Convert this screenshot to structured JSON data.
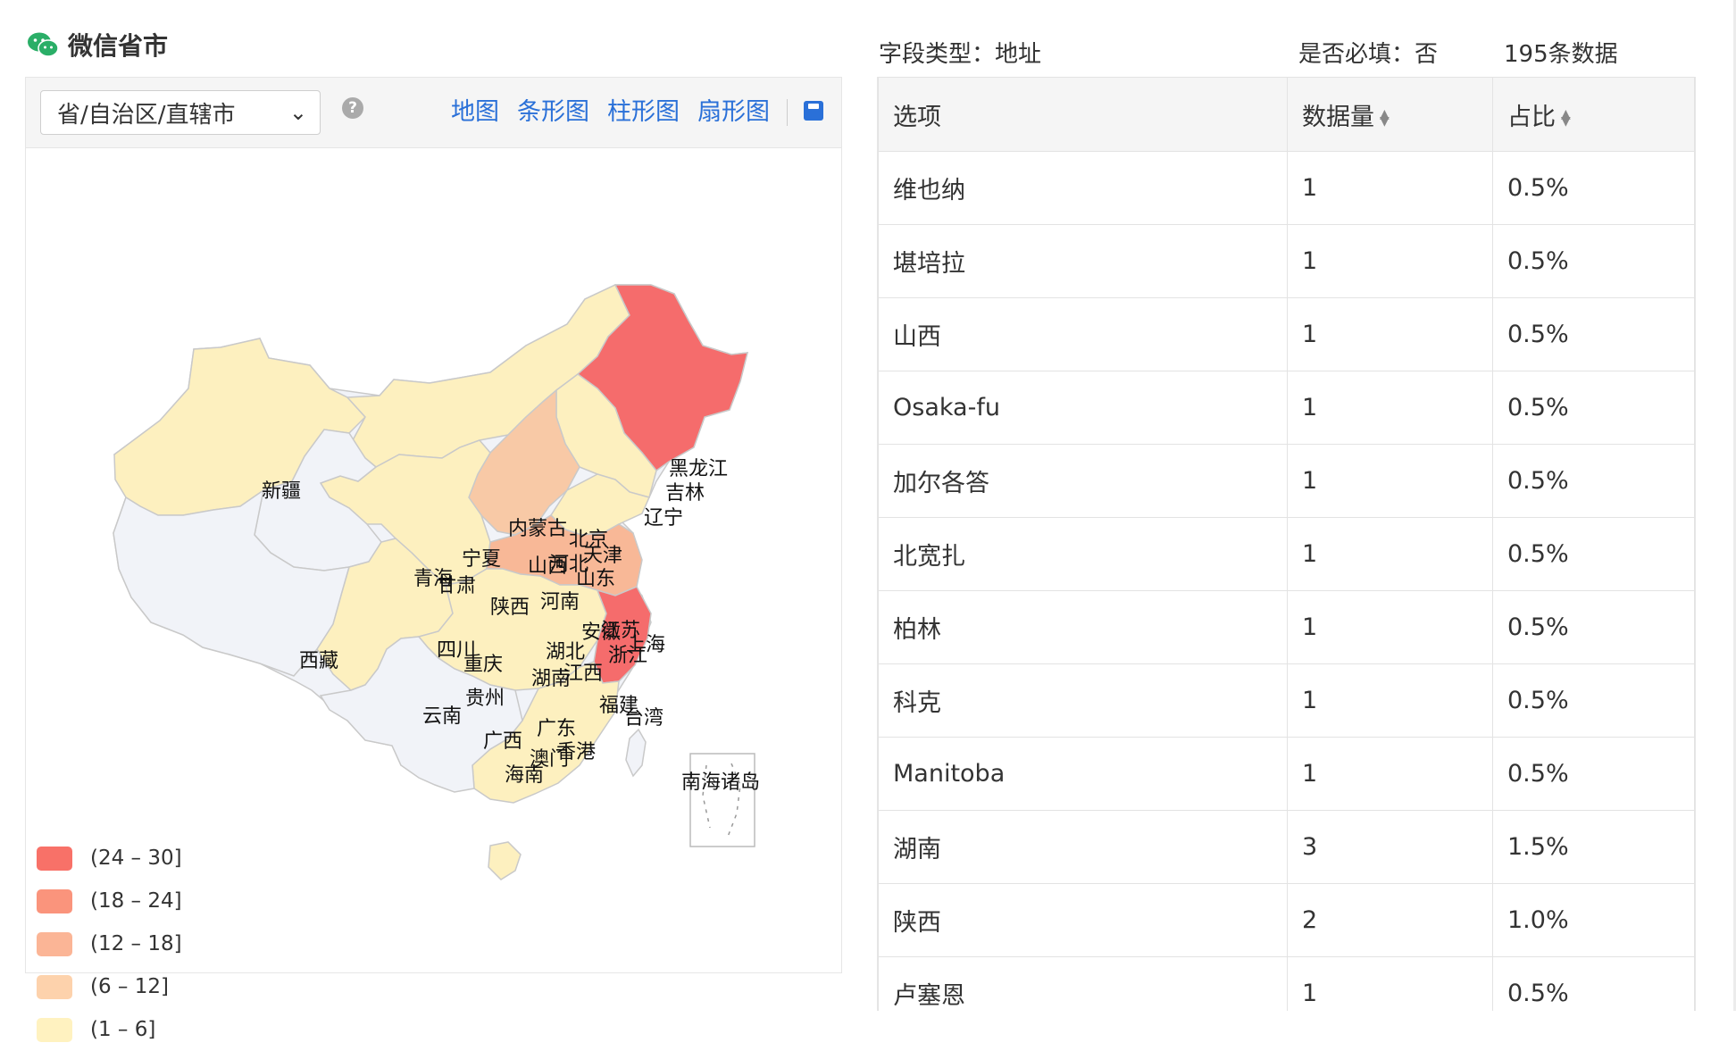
{
  "header": {
    "title": "微信省市",
    "icon": "wechat-icon"
  },
  "toolbar": {
    "select_value": "省/自治区/直辖市",
    "help_icon": "?",
    "tabs": [
      "地图",
      "条形图",
      "柱形图",
      "扇形图"
    ],
    "save_icon": "save-icon"
  },
  "map": {
    "regions": [
      {
        "name": "黑龙江"
      },
      {
        "name": "吉林"
      },
      {
        "name": "辽宁"
      },
      {
        "name": "内蒙古"
      },
      {
        "name": "新疆"
      },
      {
        "name": "北京"
      },
      {
        "name": "天津"
      },
      {
        "name": "宁夏"
      },
      {
        "name": "山西"
      },
      {
        "name": "河北"
      },
      {
        "name": "青海"
      },
      {
        "name": "甘肃"
      },
      {
        "name": "山东"
      },
      {
        "name": "陕西"
      },
      {
        "name": "河南"
      },
      {
        "name": "安徽"
      },
      {
        "name": "江苏"
      },
      {
        "name": "上海"
      },
      {
        "name": "西藏"
      },
      {
        "name": "四川"
      },
      {
        "name": "湖北"
      },
      {
        "name": "浙江"
      },
      {
        "name": "重庆"
      },
      {
        "name": "湖南"
      },
      {
        "name": "江西"
      },
      {
        "name": "贵州"
      },
      {
        "name": "福建"
      },
      {
        "name": "台湾"
      },
      {
        "name": "云南"
      },
      {
        "name": "广东"
      },
      {
        "name": "广西"
      },
      {
        "name": "香港"
      },
      {
        "name": "澳门"
      },
      {
        "name": "海南"
      },
      {
        "name": "南海诸岛"
      }
    ],
    "colors": {
      "high": "#f56c6c",
      "orange": "#f8b897",
      "peach": "#fdd3b0",
      "yellow": "#fdf0bf",
      "none": "#f1f3f8",
      "border": "#c9c9c9"
    }
  },
  "legend": [
    {
      "label": "(24 – 30]",
      "color": "#f87168"
    },
    {
      "label": "(18 – 24]",
      "color": "#fa947c"
    },
    {
      "label": "(12 – 18]",
      "color": "#fbb596"
    },
    {
      "label": "(6 – 12]",
      "color": "#fdd2ac"
    },
    {
      "label": "(1 – 6]",
      "color": "#fff2c0"
    }
  ],
  "meta": {
    "field_type": "字段类型：地址",
    "required": "是否必填：否",
    "count": "195条数据"
  },
  "table": {
    "headers": [
      "选项",
      "数据量",
      "占比"
    ],
    "rows": [
      [
        "维也纳",
        "1",
        "0.5%"
      ],
      [
        "堪培拉",
        "1",
        "0.5%"
      ],
      [
        "山西",
        "1",
        "0.5%"
      ],
      [
        "Osaka-fu",
        "1",
        "0.5%"
      ],
      [
        "加尔各答",
        "1",
        "0.5%"
      ],
      [
        "北宽扎",
        "1",
        "0.5%"
      ],
      [
        "柏林",
        "1",
        "0.5%"
      ],
      [
        "科克",
        "1",
        "0.5%"
      ],
      [
        "Manitoba",
        "1",
        "0.5%"
      ],
      [
        "湖南",
        "3",
        "1.5%"
      ],
      [
        "陕西",
        "2",
        "1.0%"
      ],
      [
        "卢塞恩",
        "1",
        "0.5%"
      ]
    ]
  }
}
